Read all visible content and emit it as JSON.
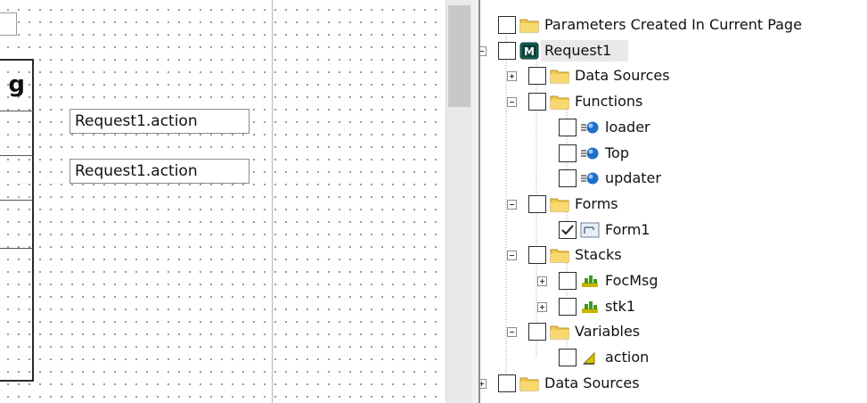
{
  "designer": {
    "fields": [
      {
        "value": "Request1.action"
      },
      {
        "value": "Request1.action"
      }
    ],
    "frame_glyph": "g"
  },
  "tree": {
    "items": [
      {
        "label": "Parameters Created In Current Page",
        "icon": "folder-icon",
        "checked": false,
        "expander": "none"
      },
      {
        "label": "Request1",
        "icon": "module-icon",
        "checked": false,
        "expander": "minus",
        "selected": true
      },
      {
        "label": "Data Sources",
        "icon": "folder-icon",
        "checked": false,
        "expander": "plus"
      },
      {
        "label": "Functions",
        "icon": "folder-icon",
        "checked": false,
        "expander": "minus"
      },
      {
        "label": "loader",
        "icon": "function-icon",
        "checked": false,
        "expander": "none"
      },
      {
        "label": "Top",
        "icon": "function-icon",
        "checked": false,
        "expander": "none"
      },
      {
        "label": "updater",
        "icon": "function-icon",
        "checked": false,
        "expander": "none"
      },
      {
        "label": "Forms",
        "icon": "folder-icon",
        "checked": false,
        "expander": "minus"
      },
      {
        "label": "Form1",
        "icon": "form-icon",
        "checked": true,
        "expander": "none"
      },
      {
        "label": "Stacks",
        "icon": "folder-icon",
        "checked": false,
        "expander": "minus"
      },
      {
        "label": "FocMsg",
        "icon": "stack-icon",
        "checked": false,
        "expander": "plus"
      },
      {
        "label": "stk1",
        "icon": "stack-icon",
        "checked": false,
        "expander": "plus"
      },
      {
        "label": "Variables",
        "icon": "folder-icon",
        "checked": false,
        "expander": "minus"
      },
      {
        "label": "action",
        "icon": "variable-icon",
        "checked": false,
        "expander": "none"
      },
      {
        "label": "Data Sources",
        "icon": "folder-icon",
        "checked": false,
        "expander": "plus"
      }
    ],
    "module_letter": "M"
  },
  "colors": {
    "folder": "#f2c84b",
    "module": "#0f6b5c",
    "function": "#1f6fc4",
    "stack": "#c9b400",
    "variable": "#d4c200"
  }
}
